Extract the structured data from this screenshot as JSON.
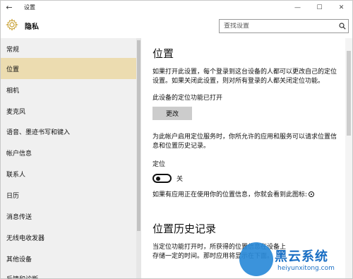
{
  "window": {
    "title": "设置",
    "back_icon": "back-arrow-icon",
    "controls": [
      "minimize-icon",
      "maximize-icon",
      "close-icon"
    ]
  },
  "header": {
    "title": "隐私",
    "icon": "gear-icon"
  },
  "search": {
    "placeholder": "查找设置",
    "icon": "search-icon"
  },
  "sidebar": {
    "items": [
      {
        "label": "常规",
        "active": false
      },
      {
        "label": "位置",
        "active": true
      },
      {
        "label": "相机",
        "active": false
      },
      {
        "label": "麦克风",
        "active": false
      },
      {
        "label": "语音、墨迹书写和键入",
        "active": false
      },
      {
        "label": "帐户信息",
        "active": false
      },
      {
        "label": "联系人",
        "active": false
      },
      {
        "label": "日历",
        "active": false
      },
      {
        "label": "消息传送",
        "active": false
      },
      {
        "label": "无线电收发器",
        "active": false
      },
      {
        "label": "其他设备",
        "active": false
      },
      {
        "label": "反馈和诊断",
        "active": false
      }
    ],
    "active_color": "#ecdcb0"
  },
  "main": {
    "heading": "位置",
    "intro": "如果打开此设置，每个登录到这台设备的人都可以更改自己的定位设置。如果关闭此设置，则对所有登录的人都关闭定位功能。",
    "device_status": "此设备的定位功能已打开",
    "change_button": "更改",
    "service_desc": "为此帐户启用定位服务时，你所允许的应用和服务可以请求位置信息和位置历史记录。",
    "location_label": "定位",
    "toggle_state": "关",
    "icon_hint": "如果有应用正在使用你的位置信息，你就会看到此图标:",
    "history_heading": "位置历史记录",
    "history_desc": "当定位功能打开时，所获得的位置信息在设备上存储一定的时间。那时应用将显示在下面。"
  },
  "watermark": {
    "title": "黑云系统",
    "url": "heiyunxitong.com",
    "color": "#1a6fc4"
  }
}
